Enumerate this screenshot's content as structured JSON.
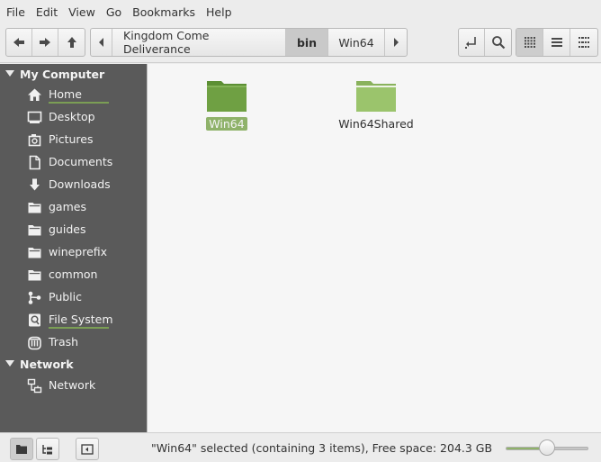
{
  "menubar": {
    "items": [
      "File",
      "Edit",
      "View",
      "Go",
      "Bookmarks",
      "Help"
    ]
  },
  "toolbar": {
    "nav_buttons": [
      "back-icon",
      "forward-icon",
      "up-icon"
    ],
    "breadcrumbs": [
      "Kingdom Come Deliverance",
      "bin",
      "Win64"
    ],
    "active_crumb": "bin",
    "tool_buttons": [
      "toggle-location-icon",
      "search-icon"
    ],
    "view_buttons": [
      "icon-view-icon",
      "list-view-icon",
      "compact-view-icon"
    ],
    "active_view": "icon-view-icon"
  },
  "sidebar": {
    "sections": [
      {
        "title": "My Computer",
        "items": [
          {
            "label": "Home",
            "icon": "home-icon"
          },
          {
            "label": "Desktop",
            "icon": "desktop-icon"
          },
          {
            "label": "Pictures",
            "icon": "pictures-icon"
          },
          {
            "label": "Documents",
            "icon": "documents-icon"
          },
          {
            "label": "Downloads",
            "icon": "downloads-icon"
          },
          {
            "label": "games",
            "icon": "folder-icon"
          },
          {
            "label": "guides",
            "icon": "folder-icon"
          },
          {
            "label": "wineprefix",
            "icon": "folder-icon"
          },
          {
            "label": "common",
            "icon": "folder-icon"
          },
          {
            "label": "Public",
            "icon": "share-icon"
          },
          {
            "label": "File System",
            "icon": "drive-icon"
          },
          {
            "label": "Trash",
            "icon": "trash-icon"
          }
        ]
      },
      {
        "title": "Network",
        "items": [
          {
            "label": "Network",
            "icon": "network-icon"
          }
        ]
      }
    ]
  },
  "files": [
    {
      "name": "Win64",
      "selected": true,
      "color": "#6fa043"
    },
    {
      "name": "Win64Shared",
      "selected": false,
      "color": "#9bc46c"
    }
  ],
  "statusbar": {
    "text": "\"Win64\" selected (containing 3 items), Free space: 204.3 GB",
    "zoom_level": 0.5
  },
  "colors": {
    "accent": "#8fb26a",
    "sidebar_bg": "#5a5a5a"
  }
}
